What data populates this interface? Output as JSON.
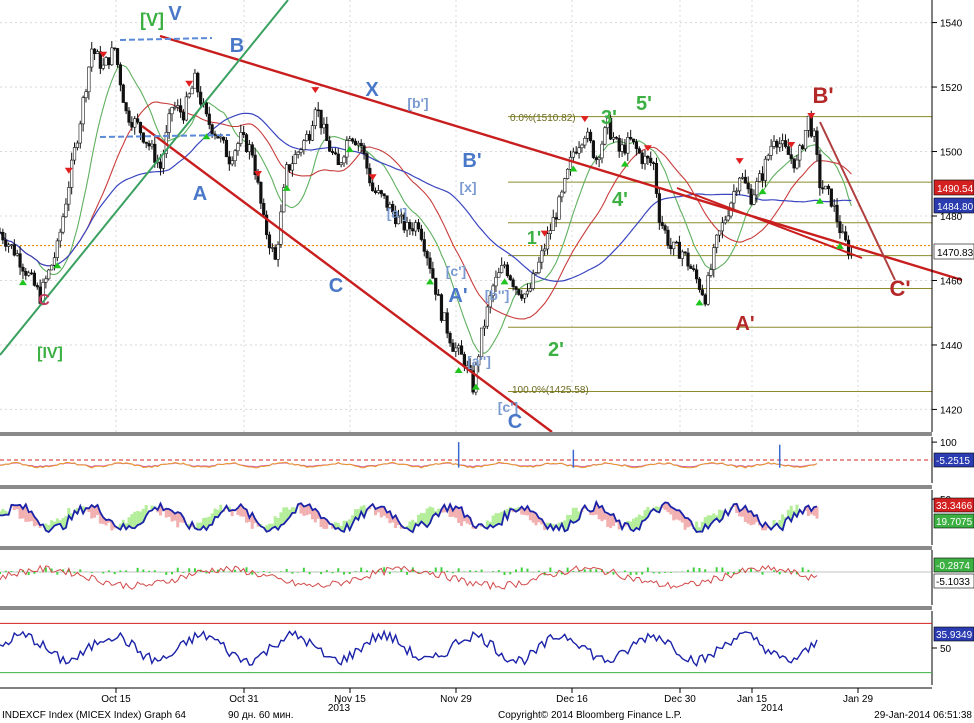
{
  "chart_data": {
    "type": "candlestick",
    "instrument_label": "INDEXCF Index (MICEX Index) Graph 64",
    "period_label": "90 дн. 60 мин.",
    "copyright": "Copyright© 2014 Bloomberg Finance L.P.",
    "timestamp": "29-Jan-2014 06:51:38",
    "x_ticks": [
      "Oct 15",
      "Oct 31",
      "Nov 15",
      "Nov 29",
      "Dec 16",
      "Dec 30",
      "Jan 15",
      "Jan 29"
    ],
    "year_labels": [
      "2013",
      "2014"
    ],
    "y_range": [
      1413,
      1547
    ],
    "y_ticks": [
      1420,
      1440,
      1460,
      1480,
      1500,
      1520,
      1540
    ],
    "price_tags": [
      {
        "value": "1490.54",
        "color": "#d32020"
      },
      {
        "value": "1484.80",
        "color": "#2a3cb0"
      },
      {
        "value": "1470.83",
        "color": "#000000"
      }
    ],
    "fib_labels": [
      "0.0%(1510.82)",
      "100.0%(1425.58)"
    ],
    "fib_levels": [
      1510.82,
      1490.5,
      1477.9,
      1467.7,
      1457.5,
      1445.5,
      1425.58
    ],
    "current_level": 1470.83,
    "price_path": [
      [
        0,
        1475
      ],
      [
        6,
        1468
      ],
      [
        14,
        1455
      ],
      [
        20,
        1470
      ],
      [
        24,
        1490
      ],
      [
        28,
        1510
      ],
      [
        32,
        1532
      ],
      [
        36,
        1526
      ],
      [
        40,
        1532
      ],
      [
        44,
        1512
      ],
      [
        48,
        1508
      ],
      [
        52,
        1502
      ],
      [
        56,
        1495
      ],
      [
        60,
        1514
      ],
      [
        64,
        1512
      ],
      [
        68,
        1522
      ],
      [
        72,
        1510
      ],
      [
        76,
        1505
      ],
      [
        80,
        1498
      ],
      [
        84,
        1504
      ],
      [
        88,
        1500
      ],
      [
        92,
        1478
      ],
      [
        96,
        1466
      ],
      [
        100,
        1494
      ],
      [
        104,
        1500
      ],
      [
        108,
        1506
      ],
      [
        110,
        1515
      ],
      [
        114,
        1503
      ],
      [
        118,
        1495
      ],
      [
        122,
        1506
      ],
      [
        126,
        1502
      ],
      [
        130,
        1488
      ],
      [
        134,
        1485
      ],
      [
        138,
        1480
      ],
      [
        142,
        1476
      ],
      [
        146,
        1478
      ],
      [
        150,
        1465
      ],
      [
        154,
        1450
      ],
      [
        158,
        1440
      ],
      [
        162,
        1435
      ],
      [
        165,
        1427
      ],
      [
        168,
        1443
      ],
      [
        172,
        1458
      ],
      [
        176,
        1465
      ],
      [
        180,
        1458
      ],
      [
        184,
        1455
      ],
      [
        188,
        1465
      ],
      [
        192,
        1476
      ],
      [
        196,
        1486
      ],
      [
        200,
        1500
      ],
      [
        204,
        1506
      ],
      [
        208,
        1498
      ],
      [
        212,
        1508
      ],
      [
        216,
        1500
      ],
      [
        220,
        1503
      ],
      [
        224,
        1498
      ],
      [
        228,
        1496
      ],
      [
        230,
        1480
      ],
      [
        234,
        1470
      ],
      [
        238,
        1469
      ],
      [
        242,
        1462
      ],
      [
        246,
        1455
      ],
      [
        250,
        1472
      ],
      [
        254,
        1482
      ],
      [
        258,
        1493
      ],
      [
        262,
        1486
      ],
      [
        266,
        1493
      ],
      [
        270,
        1505
      ],
      [
        274,
        1500
      ],
      [
        278,
        1496
      ],
      [
        282,
        1510
      ],
      [
        284,
        1504
      ],
      [
        286,
        1490
      ],
      [
        290,
        1485
      ],
      [
        294,
        1473
      ],
      [
        297,
        1468
      ]
    ],
    "x_max": 300,
    "wave_labels": [
      {
        "text": "[V]",
        "color": "#3cb043"
      },
      {
        "text": "V",
        "color": "#4a78c8"
      },
      {
        "text": "B",
        "color": "#4a78c8"
      },
      {
        "text": "A",
        "color": "#4a78c8"
      },
      {
        "text": "C",
        "color": "#c0395c"
      },
      {
        "text": "[IV]",
        "color": "#3cb043"
      },
      {
        "text": "X",
        "color": "#4a78c8"
      },
      {
        "text": "[b']",
        "color": "#7a9ad0"
      },
      {
        "text": "[a']",
        "color": "#7a9ad0"
      },
      {
        "text": "C",
        "color": "#4a78c8"
      },
      {
        "text": "B'",
        "color": "#4a78c8"
      },
      {
        "text": "[x]",
        "color": "#7a9ad0"
      },
      {
        "text": "[c']",
        "color": "#7a9ad0"
      },
      {
        "text": "A'",
        "color": "#4a78c8"
      },
      {
        "text": "[b'']",
        "color": "#7a9ad0"
      },
      {
        "text": "[a'']",
        "color": "#7a9ad0"
      },
      {
        "text": "[c']",
        "color": "#7a9ad0"
      },
      {
        "text": "C",
        "color": "#4a78c8"
      },
      {
        "text": "1'",
        "color": "#3cb043"
      },
      {
        "text": "2'",
        "color": "#3cb043"
      },
      {
        "text": "3'",
        "color": "#3cb043"
      },
      {
        "text": "4'",
        "color": "#3cb043"
      },
      {
        "text": "5'",
        "color": "#3cb043"
      },
      {
        "text": "A'",
        "color": "#b52828"
      },
      {
        "text": "B'",
        "color": "#b52828"
      },
      {
        "text": "C'",
        "color": "#b52828"
      }
    ],
    "indicators": [
      {
        "name": "osc1",
        "range": [
          -60,
          120
        ],
        "ticks": [
          "100"
        ],
        "tags": [
          {
            "value": "-5.2515",
            "color": "#2a3cb0"
          }
        ]
      },
      {
        "name": "stoch",
        "range": [
          0,
          60
        ],
        "ticks": [
          "50"
        ],
        "tags": [
          {
            "value": "33.3466",
            "color": "#d32020"
          },
          {
            "value": "19.7075",
            "color": "#3cb043"
          }
        ]
      },
      {
        "name": "macd",
        "range": [
          -12,
          8
        ],
        "ticks": [],
        "tags": [
          {
            "value": "-0.2874",
            "color": "#3cb043"
          },
          {
            "value": "-5.1033",
            "color": "#ffffff"
          }
        ]
      },
      {
        "name": "rsi",
        "range": [
          20,
          80
        ],
        "ticks": [
          "50"
        ],
        "tags": [
          {
            "value": "35.9349",
            "color": "#2a3cb0"
          }
        ]
      }
    ]
  }
}
